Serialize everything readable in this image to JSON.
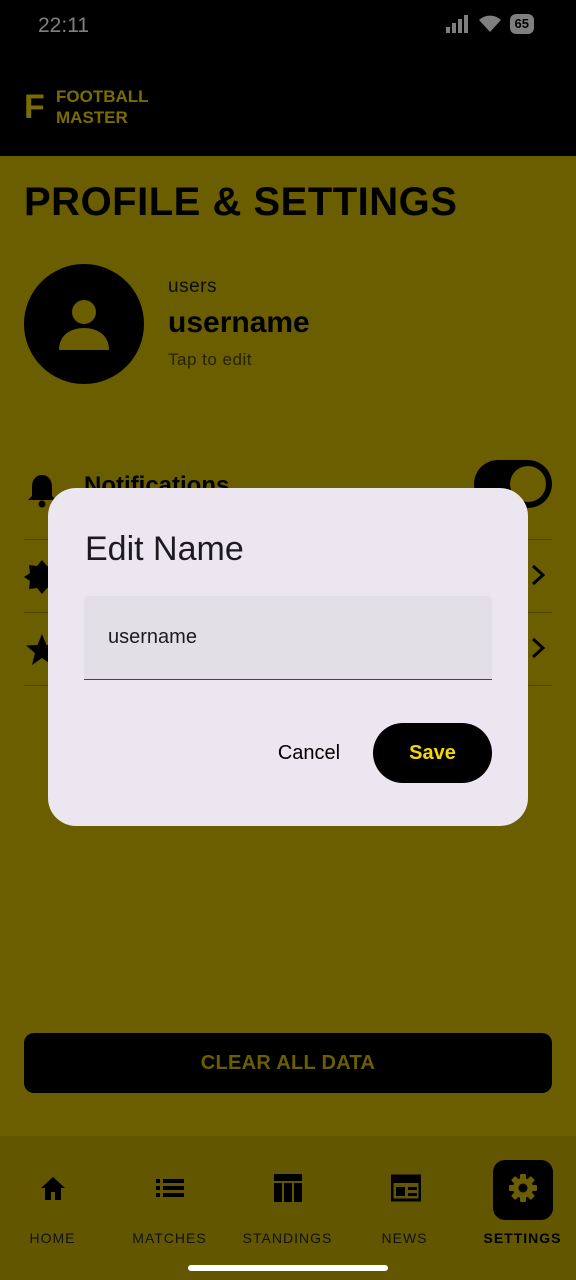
{
  "status_bar": {
    "time": "22:11",
    "battery": "65"
  },
  "app_bar": {
    "logo_letter": "F",
    "logo_line1": "FOOTBALL",
    "logo_line2": "MASTER"
  },
  "page": {
    "title": "PROFILE & SETTINGS"
  },
  "profile": {
    "subtitle": "users",
    "name": "username",
    "hint": "Tap to edit"
  },
  "settings": {
    "notifications_label": "Notifications",
    "notifications_on": true
  },
  "clear_button": "CLEAR ALL DATA",
  "nav": {
    "items": [
      {
        "label": "HOME",
        "icon": "home-icon"
      },
      {
        "label": "MATCHES",
        "icon": "list-icon"
      },
      {
        "label": "STANDINGS",
        "icon": "table-icon"
      },
      {
        "label": "NEWS",
        "icon": "newspaper-icon"
      },
      {
        "label": "SETTINGS",
        "icon": "gear-icon",
        "active": true
      }
    ]
  },
  "dialog": {
    "title": "Edit Name",
    "field_value": "username",
    "cancel_label": "Cancel",
    "save_label": "Save"
  },
  "colors": {
    "accent": "#f5d800",
    "background": "#d4bd00",
    "dialog": "#ebe6ef"
  }
}
